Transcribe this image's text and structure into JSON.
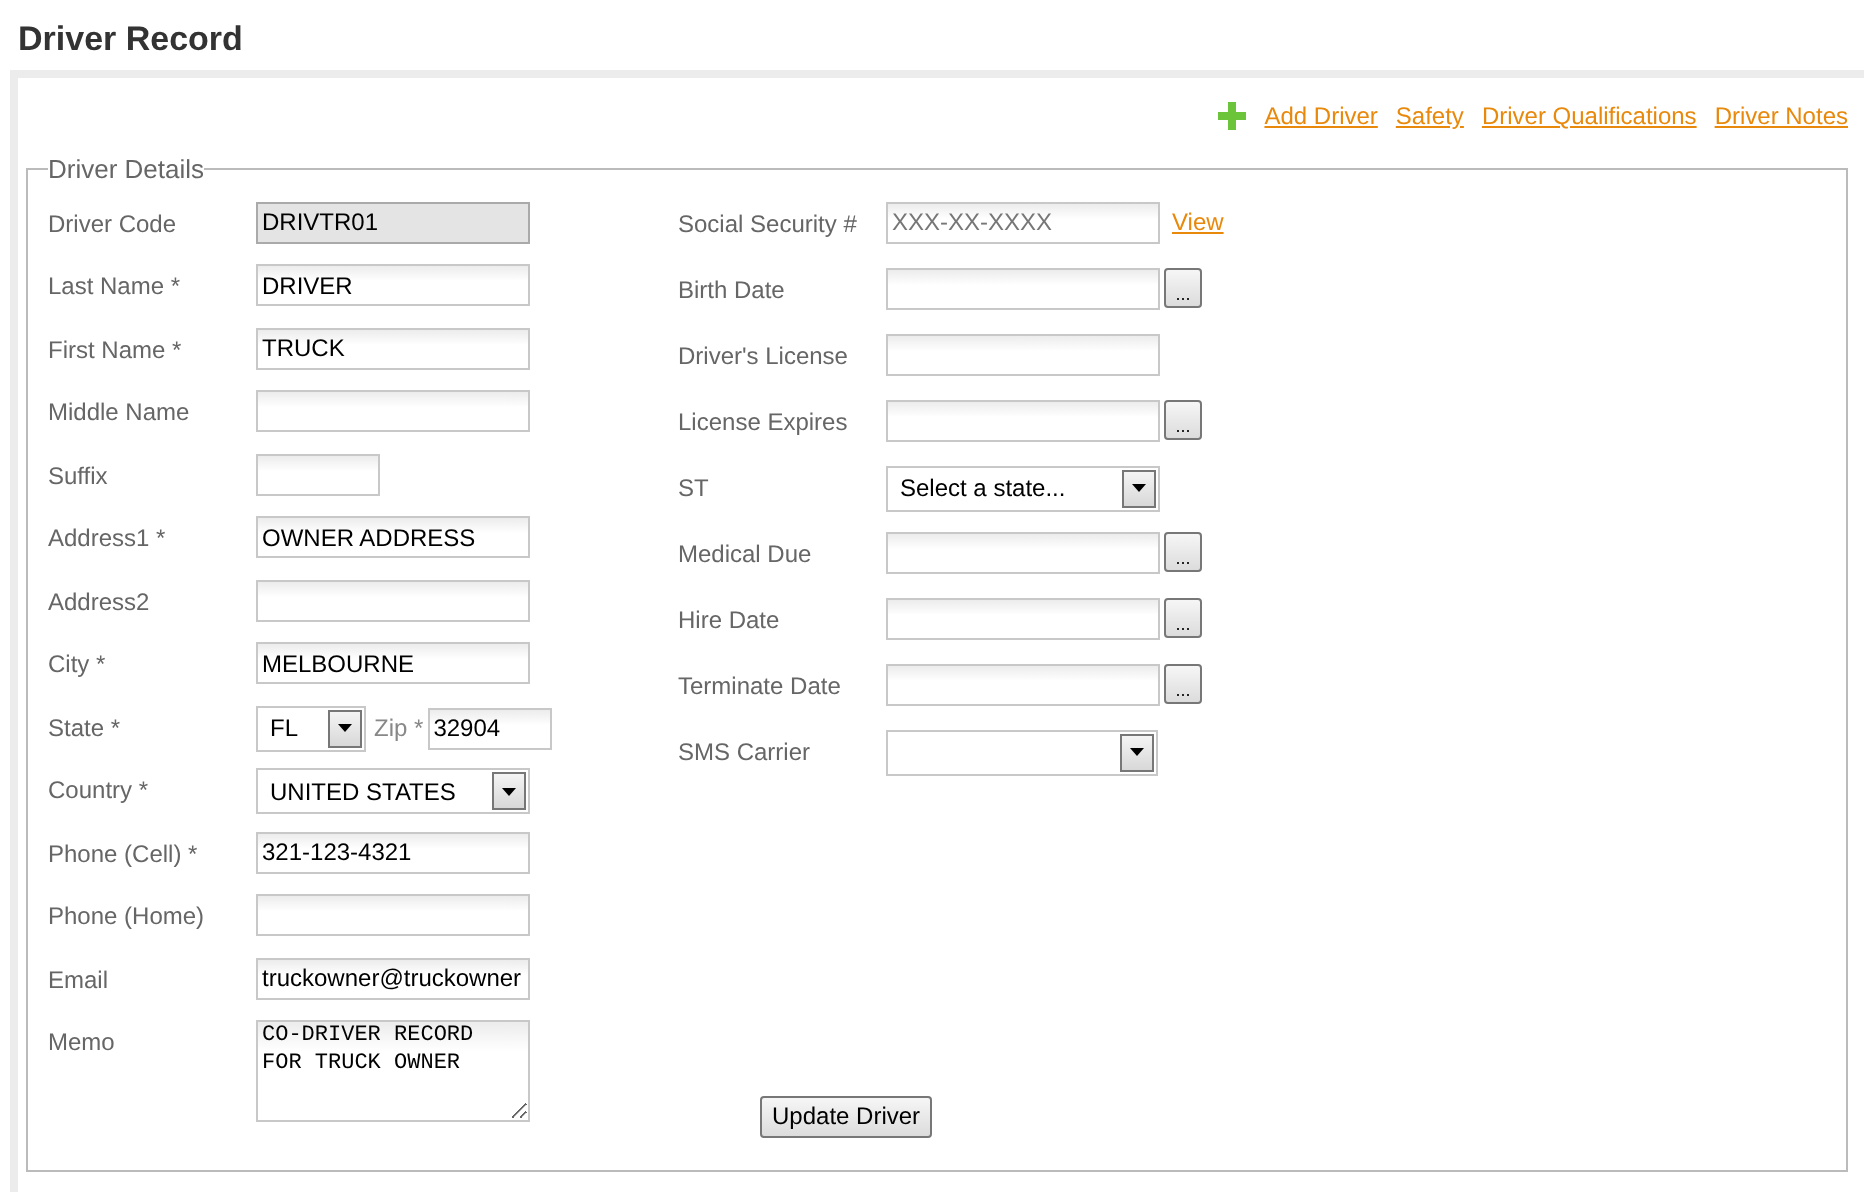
{
  "page_title": "Driver Record",
  "links": [
    {
      "label": "Add Driver",
      "kind": "add"
    },
    {
      "label": "Safety",
      "kind": "plain"
    },
    {
      "label": "Driver Qualifications",
      "kind": "plain"
    },
    {
      "label": "Driver Notes",
      "kind": "plain"
    }
  ],
  "legend": "Driver Details",
  "left_fields": [
    {
      "label": "Driver Code",
      "kind": "readonly",
      "value": "DRIVTR01"
    },
    {
      "label": "Last Name *",
      "kind": "text",
      "value": "DRIVER"
    },
    {
      "label": "First Name *",
      "kind": "text",
      "value": "TRUCK"
    },
    {
      "label": "Middle Name",
      "kind": "text"
    },
    {
      "label": "Suffix",
      "kind": "short"
    },
    {
      "label": "Address1 *",
      "kind": "text",
      "value": "OWNER ADDRESS"
    },
    {
      "label": "Address2",
      "kind": "text"
    },
    {
      "label": "City *",
      "kind": "text",
      "value": "MELBOURNE"
    },
    {
      "label": "State *",
      "kind": "state_zip",
      "value": "FL",
      "zip_label": "Zip *",
      "zip_value": "32904"
    },
    {
      "label": "Country *",
      "kind": "select",
      "value": "UNITED STATES"
    },
    {
      "label": "Phone (Cell) *",
      "kind": "text",
      "value": "321-123-4321"
    },
    {
      "label": "Phone (Home)",
      "kind": "text"
    },
    {
      "label": "Email",
      "kind": "text",
      "value": "truckowner@truckowner"
    },
    {
      "label": "Memo",
      "kind": "memo",
      "value": "CO-DRIVER RECORD\nFOR TRUCK OWNER"
    }
  ],
  "right_fields": [
    {
      "label": "Social Security #",
      "kind": "masked",
      "placeholder": "XXX-XX-XXXX",
      "link": "View"
    },
    {
      "label": "Birth Date",
      "kind": "date",
      "button": "..."
    },
    {
      "label": "Driver's License",
      "kind": "text"
    },
    {
      "label": "License Expires",
      "kind": "date",
      "button": "..."
    },
    {
      "label": "ST",
      "kind": "select",
      "value": "Select a state..."
    },
    {
      "label": "Medical Due",
      "kind": "date",
      "button": "..."
    },
    {
      "label": "Hire Date",
      "kind": "date",
      "button": "..."
    },
    {
      "label": "Terminate Date",
      "kind": "date",
      "button": "..."
    },
    {
      "label": "SMS Carrier",
      "kind": "select"
    }
  ],
  "submit": "Update Driver"
}
